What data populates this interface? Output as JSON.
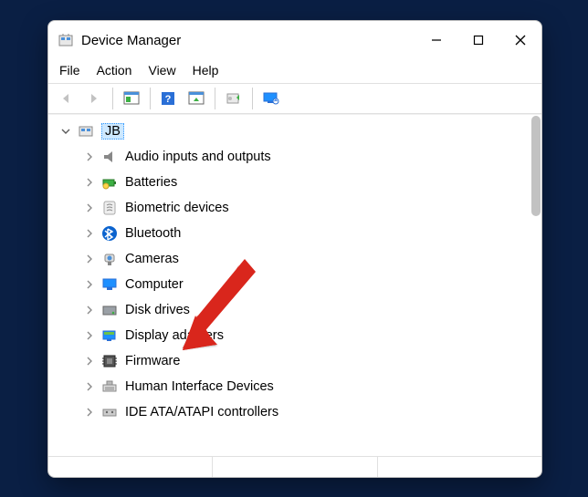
{
  "titlebar": {
    "title": "Device Manager"
  },
  "menu": {
    "file": "File",
    "action": "Action",
    "view": "View",
    "help": "Help"
  },
  "toolbar": {
    "back": "back-icon",
    "forward": "forward-icon",
    "show_hide": "show-hide-console-tree-icon",
    "help": "help-icon",
    "scan": "scan-for-hardware-changes-icon",
    "add_driver": "add-driver-icon",
    "remote": "connect-remote-icon"
  },
  "tree": {
    "root": {
      "label": "JB",
      "expanded": true
    },
    "items": [
      {
        "label": "Audio inputs and outputs",
        "icon": "speaker-icon"
      },
      {
        "label": "Batteries",
        "icon": "battery-icon"
      },
      {
        "label": "Biometric devices",
        "icon": "fingerprint-icon"
      },
      {
        "label": "Bluetooth",
        "icon": "bluetooth-icon"
      },
      {
        "label": "Cameras",
        "icon": "camera-icon"
      },
      {
        "label": "Computer",
        "icon": "monitor-icon"
      },
      {
        "label": "Disk drives",
        "icon": "drive-icon"
      },
      {
        "label": "Display adapters",
        "icon": "display-adapter-icon"
      },
      {
        "label": "Firmware",
        "icon": "firmware-chip-icon"
      },
      {
        "label": "Human Interface Devices",
        "icon": "hid-icon"
      },
      {
        "label": "IDE ATA/ATAPI controllers",
        "icon": "controller-icon"
      }
    ]
  },
  "colors": {
    "accent": "#cde8ff"
  }
}
